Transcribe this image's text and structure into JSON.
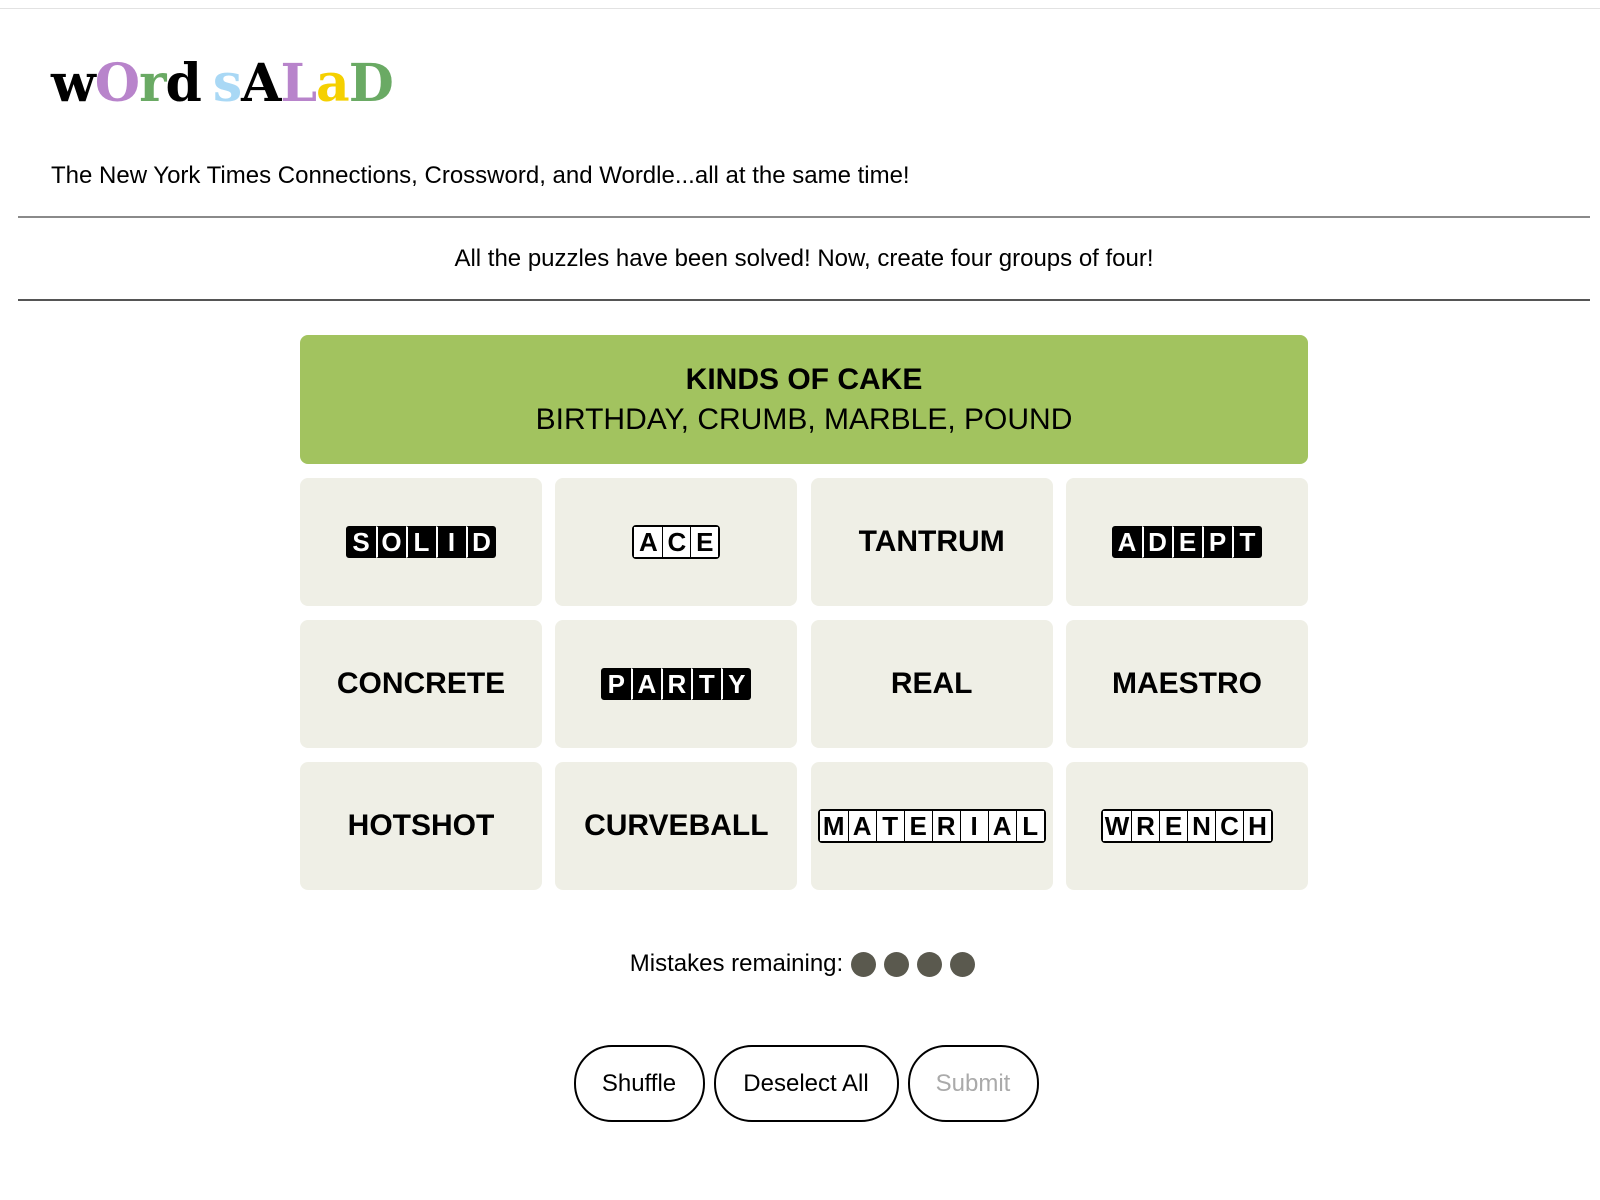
{
  "logo": {
    "letters": [
      {
        "char": "w",
        "color": "#000000"
      },
      {
        "char": "O",
        "color": "#b884cb"
      },
      {
        "char": "r",
        "color": "#6aaa64"
      },
      {
        "char": "d",
        "color": "#000000"
      },
      {
        "char": " ",
        "color": "#000000"
      },
      {
        "char": "s",
        "color": "#a9d8f5"
      },
      {
        "char": "A",
        "color": "#000000"
      },
      {
        "char": "L",
        "color": "#b884cb"
      },
      {
        "char": "a",
        "color": "#f5d000"
      },
      {
        "char": "D",
        "color": "#6aaa64"
      }
    ]
  },
  "subtitle": "The New York Times Connections, Crossword, and Wordle...all at the same time!",
  "banner": "All the puzzles have been solved! Now, create four groups of four!",
  "solved_group": {
    "title": "KINDS OF CAKE",
    "members": "BIRTHDAY, CRUMB, MARBLE, POUND",
    "color": "#a2c35f"
  },
  "tiles": [
    {
      "word": "SOLID",
      "style": "dark"
    },
    {
      "word": "ACE",
      "style": "light"
    },
    {
      "word": "TANTRUM",
      "style": "plain"
    },
    {
      "word": "ADEPT",
      "style": "dark"
    },
    {
      "word": "CONCRETE",
      "style": "plain"
    },
    {
      "word": "PARTY",
      "style": "dark"
    },
    {
      "word": "REAL",
      "style": "plain"
    },
    {
      "word": "MAESTRO",
      "style": "plain"
    },
    {
      "word": "HOTSHOT",
      "style": "plain"
    },
    {
      "word": "CURVEBALL",
      "style": "plain"
    },
    {
      "word": "MATERIAL",
      "style": "light"
    },
    {
      "word": "WRENCH",
      "style": "light"
    }
  ],
  "mistakes": {
    "label": "Mistakes remaining:",
    "remaining": 4,
    "dot_color": "#5a594e"
  },
  "buttons": {
    "shuffle": "Shuffle",
    "deselect": "Deselect All",
    "submit": "Submit"
  }
}
